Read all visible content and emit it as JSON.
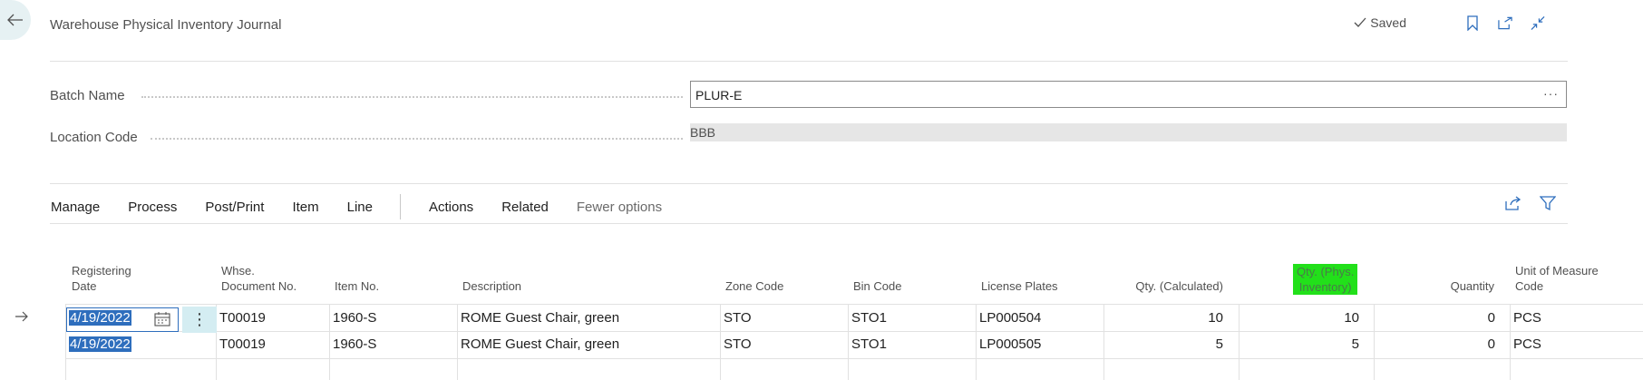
{
  "header": {
    "title": "Warehouse Physical Inventory Journal",
    "saved_label": "Saved"
  },
  "fields": {
    "batch_name_label": "Batch Name",
    "batch_name_value": "PLUR-E",
    "batch_name_ellipsis": "···",
    "location_code_label": "Location Code",
    "location_code_value": "BBB"
  },
  "action_bar": {
    "items": [
      "Manage",
      "Process",
      "Post/Print",
      "Item",
      "Line"
    ],
    "items2": [
      "Actions",
      "Related",
      "Fewer options"
    ]
  },
  "grid": {
    "columns": {
      "registering_date": "Registering\nDate",
      "whse_doc_no": "Whse.\nDocument No.",
      "item_no": "Item No.",
      "description": "Description",
      "zone_code": "Zone Code",
      "bin_code": "Bin Code",
      "license_plates": "License Plates",
      "qty_calculated": "Qty. (Calculated)",
      "qty_phys_inventory": "Qty. (Phys.\nInventory)",
      "quantity": "Quantity",
      "unit_of_measure": "Unit of Measure\nCode"
    },
    "rows": [
      {
        "date": "4/19/2022",
        "whse_doc": "T00019",
        "item_no": "1960-S",
        "description": "ROME Guest Chair, green",
        "zone": "STO",
        "bin": "STO1",
        "license": "LP000504",
        "qty_calc": "10",
        "qty_phys": "10",
        "quantity": "0",
        "uom": "PCS"
      },
      {
        "date": "4/19/2022",
        "whse_doc": "T00019",
        "item_no": "1960-S",
        "description": "ROME Guest Chair, green",
        "zone": "STO",
        "bin": "STO1",
        "license": "LP000505",
        "qty_calc": "5",
        "qty_phys": "5",
        "quantity": "0",
        "uom": "PCS"
      }
    ]
  },
  "colors": {
    "accent": "#2e6ebd",
    "highlight": "#22e01a",
    "back_bg": "#e6f1f3"
  },
  "icons": [
    "back-arrow-icon",
    "checkmark-icon",
    "bookmark-icon",
    "open-new-window-icon",
    "collapse-icon",
    "share-icon",
    "filter-icon",
    "calendar-icon",
    "row-arrow-icon",
    "row-menu-icon"
  ]
}
